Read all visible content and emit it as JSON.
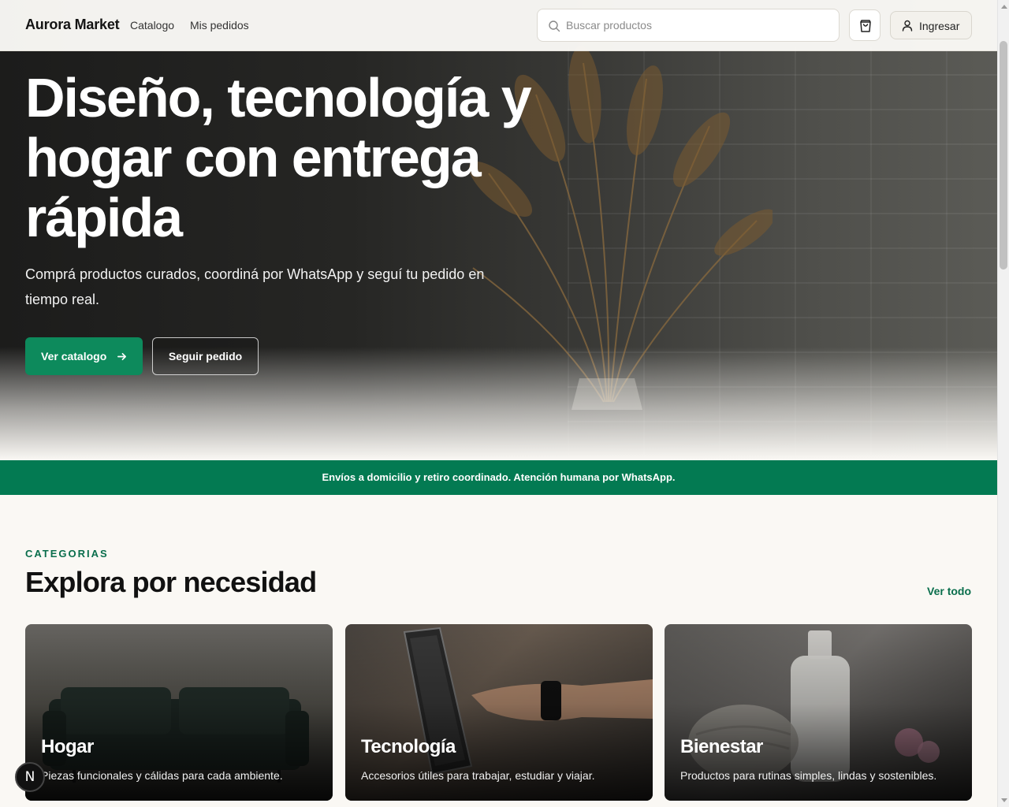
{
  "header": {
    "brand": "Aurora Market",
    "nav": [
      "Catalogo",
      "Mis pedidos"
    ],
    "search_placeholder": "Buscar productos",
    "login_label": "Ingresar"
  },
  "hero": {
    "title": "Diseño, tecnología y hogar con entrega rápida",
    "subtitle": "Comprá productos curados, coordiná por WhatsApp y seguí tu pedido en tiempo real.",
    "primary_cta": "Ver catalogo",
    "secondary_cta": "Seguir pedido"
  },
  "banner": {
    "text": "Envíos a domicilio y retiro coordinado. Atención humana por WhatsApp."
  },
  "categories": {
    "eyebrow": "CATEGORIAS",
    "title": "Explora por necesidad",
    "see_all": "Ver todo",
    "items": [
      {
        "title": "Hogar",
        "description": "Piezas funcionales y cálidas para cada ambiente."
      },
      {
        "title": "Tecnología",
        "description": "Accesorios útiles para trabajar, estudiar y viajar."
      },
      {
        "title": "Bienestar",
        "description": "Productos para rutinas simples, lindas y sostenibles."
      }
    ]
  },
  "badge": {
    "letter": "N"
  },
  "colors": {
    "accent": "#0d8a5c",
    "banner": "#037a52",
    "accent_text": "#0a6e4c"
  },
  "icons": {
    "search": "search-icon",
    "cart": "shopping-bag-icon",
    "user": "user-icon",
    "arrow": "arrow-right-icon"
  }
}
